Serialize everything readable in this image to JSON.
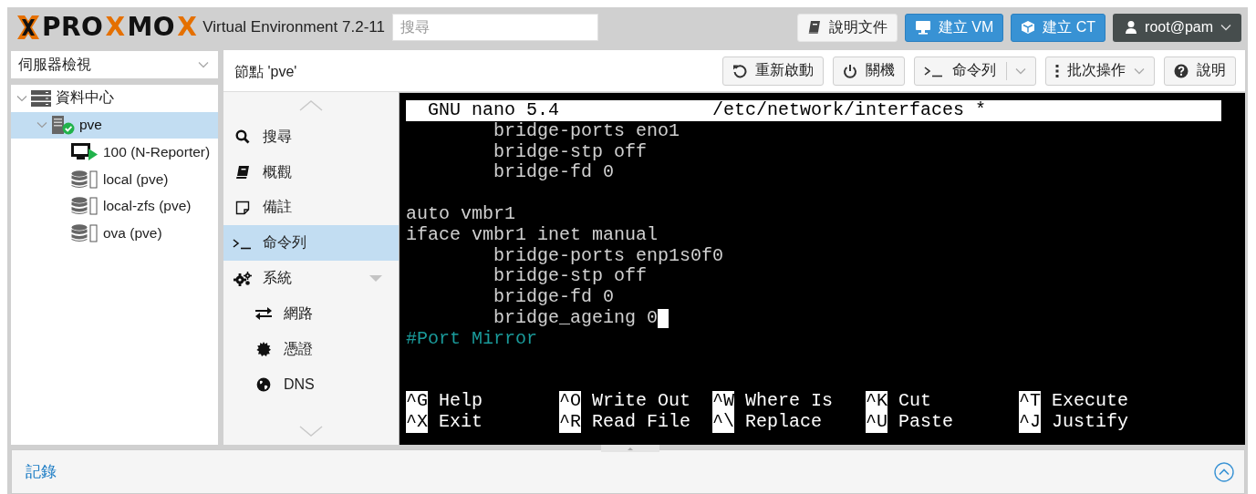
{
  "header": {
    "logo": {
      "parts": [
        {
          "text": "PRO",
          "accent": false
        },
        {
          "text": "X",
          "accent": true
        },
        {
          "text": "MO",
          "accent": false
        },
        {
          "text": "X",
          "accent": true
        }
      ]
    },
    "product": "Virtual Environment 7.2-11",
    "search": {
      "placeholder": "搜尋"
    },
    "buttons": [
      {
        "label": "說明文件",
        "kind": "light",
        "dropdown": false
      },
      {
        "label": "建立 VM",
        "kind": "primary",
        "dropdown": false
      },
      {
        "label": "建立 CT",
        "kind": "primary",
        "dropdown": false
      },
      {
        "label": "root@pam",
        "kind": "dark",
        "dropdown": true
      }
    ]
  },
  "view_selector": {
    "value": "伺服器檢視"
  },
  "tree": [
    {
      "label": "資料中心",
      "kind": "datacenter",
      "selected": false,
      "expanded": true,
      "children": [
        {
          "label": "pve",
          "kind": "node",
          "selected": true,
          "expanded": true,
          "children": [
            {
              "label": "100 (N-Reporter)",
              "kind": "vm",
              "selected": false
            },
            {
              "label": "local (pve)",
              "kind": "storage",
              "selected": false
            },
            {
              "label": "local-zfs (pve)",
              "kind": "storage",
              "selected": false
            },
            {
              "label": "ova (pve)",
              "kind": "storage",
              "selected": false
            }
          ]
        }
      ]
    }
  ],
  "toolbar": {
    "title": "節點 'pve'",
    "buttons": [
      {
        "label": "重新啟動",
        "dropdown": false,
        "split": false
      },
      {
        "label": "關機",
        "dropdown": false,
        "split": false
      },
      {
        "label": "命令列",
        "dropdown": true,
        "split": true
      },
      {
        "label": "批次操作",
        "dropdown": true,
        "split": false
      },
      {
        "label": "說明",
        "dropdown": false,
        "split": false
      }
    ]
  },
  "nav": [
    {
      "label": "搜尋",
      "selected": false
    },
    {
      "label": "概觀",
      "selected": false
    },
    {
      "label": "備註",
      "selected": false
    },
    {
      "label": "命令列",
      "selected": true
    },
    {
      "label": "系統",
      "selected": false,
      "expanded": true,
      "children": [
        {
          "label": "網路",
          "selected": false
        },
        {
          "label": "憑證",
          "selected": false
        },
        {
          "label": "DNS",
          "selected": false
        }
      ]
    }
  ],
  "terminal": {
    "title_left": "GNU nano 5.4",
    "title_right": "/etc/network/interfaces *",
    "lines": [
      {
        "kind": "indented",
        "text": "bridge-ports eno1",
        "cursor": false
      },
      {
        "kind": "indented",
        "text": "bridge-stp off",
        "cursor": false
      },
      {
        "kind": "indented",
        "text": "bridge-fd 0",
        "cursor": false
      },
      {
        "kind": "blank",
        "cursor": false
      },
      {
        "kind": "plain",
        "text": "auto vmbr1",
        "cursor": false
      },
      {
        "kind": "plain",
        "text": "iface vmbr1 inet manual",
        "cursor": false
      },
      {
        "kind": "indented",
        "text": "bridge-ports enp1s0f0",
        "cursor": false
      },
      {
        "kind": "indented",
        "text": "bridge-stp off",
        "cursor": false
      },
      {
        "kind": "indented",
        "text": "bridge-fd 0",
        "cursor": false
      },
      {
        "kind": "indented",
        "text": "bridge_ageing 0",
        "cursor": true
      },
      {
        "kind": "comment",
        "text": "#Port Mirror",
        "cursor": false
      },
      {
        "kind": "blank",
        "cursor": false
      },
      {
        "kind": "blank",
        "cursor": false
      }
    ],
    "shortcuts": [
      [
        {
          "key": "^G",
          "label": "Help"
        },
        {
          "key": "^O",
          "label": "Write Out"
        },
        {
          "key": "^W",
          "label": "Where Is"
        },
        {
          "key": "^K",
          "label": "Cut"
        },
        {
          "key": "^T",
          "label": "Execute"
        }
      ],
      [
        {
          "key": "^X",
          "label": "Exit"
        },
        {
          "key": "^R",
          "label": "Read File"
        },
        {
          "key": "^\\",
          "label": "Replace"
        },
        {
          "key": "^U",
          "label": "Paste"
        },
        {
          "key": "^J",
          "label": "Justify"
        }
      ]
    ]
  },
  "log": {
    "title": "記錄"
  }
}
